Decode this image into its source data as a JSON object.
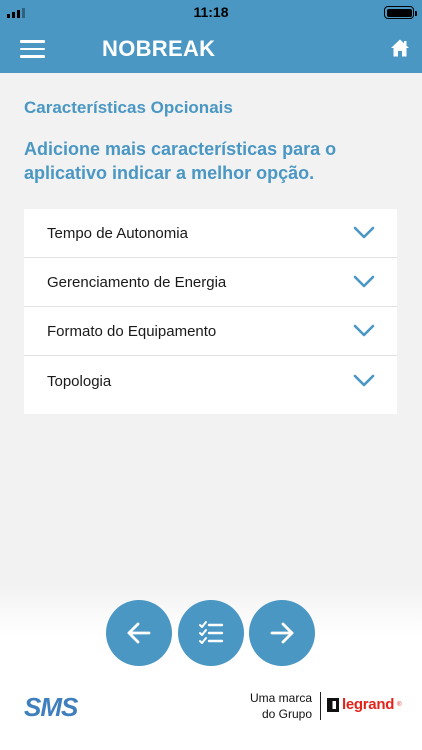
{
  "status_bar": {
    "time": "11:18"
  },
  "header": {
    "title": "NOBREAK"
  },
  "section": {
    "title": "Características Opcionais",
    "description": "Adicione mais características para o aplicativo indicar a melhor opção."
  },
  "options": [
    {
      "label": "Tempo de Autonomia",
      "icon": "chevron-down-icon"
    },
    {
      "label": "Gerenciamento de Energia",
      "icon": "chevron-down-icon"
    },
    {
      "label": "Formato do Equipamento",
      "icon": "chevron-down-icon"
    },
    {
      "label": "Topologia",
      "icon": "chevron-down-icon"
    }
  ],
  "nav": {
    "back_icon": "arrow-left-icon",
    "list_icon": "checklist-icon",
    "next_icon": "arrow-right-icon"
  },
  "footer": {
    "sms_logo": "SMS",
    "brand_line1": "Uma marca",
    "brand_line2": "do Grupo",
    "legrand_logo": "legrand"
  },
  "colors": {
    "accent": "#4a97c4",
    "background": "#f2f2f2",
    "legrand_red": "#e2231a",
    "sms_blue": "#3f7fbd"
  }
}
